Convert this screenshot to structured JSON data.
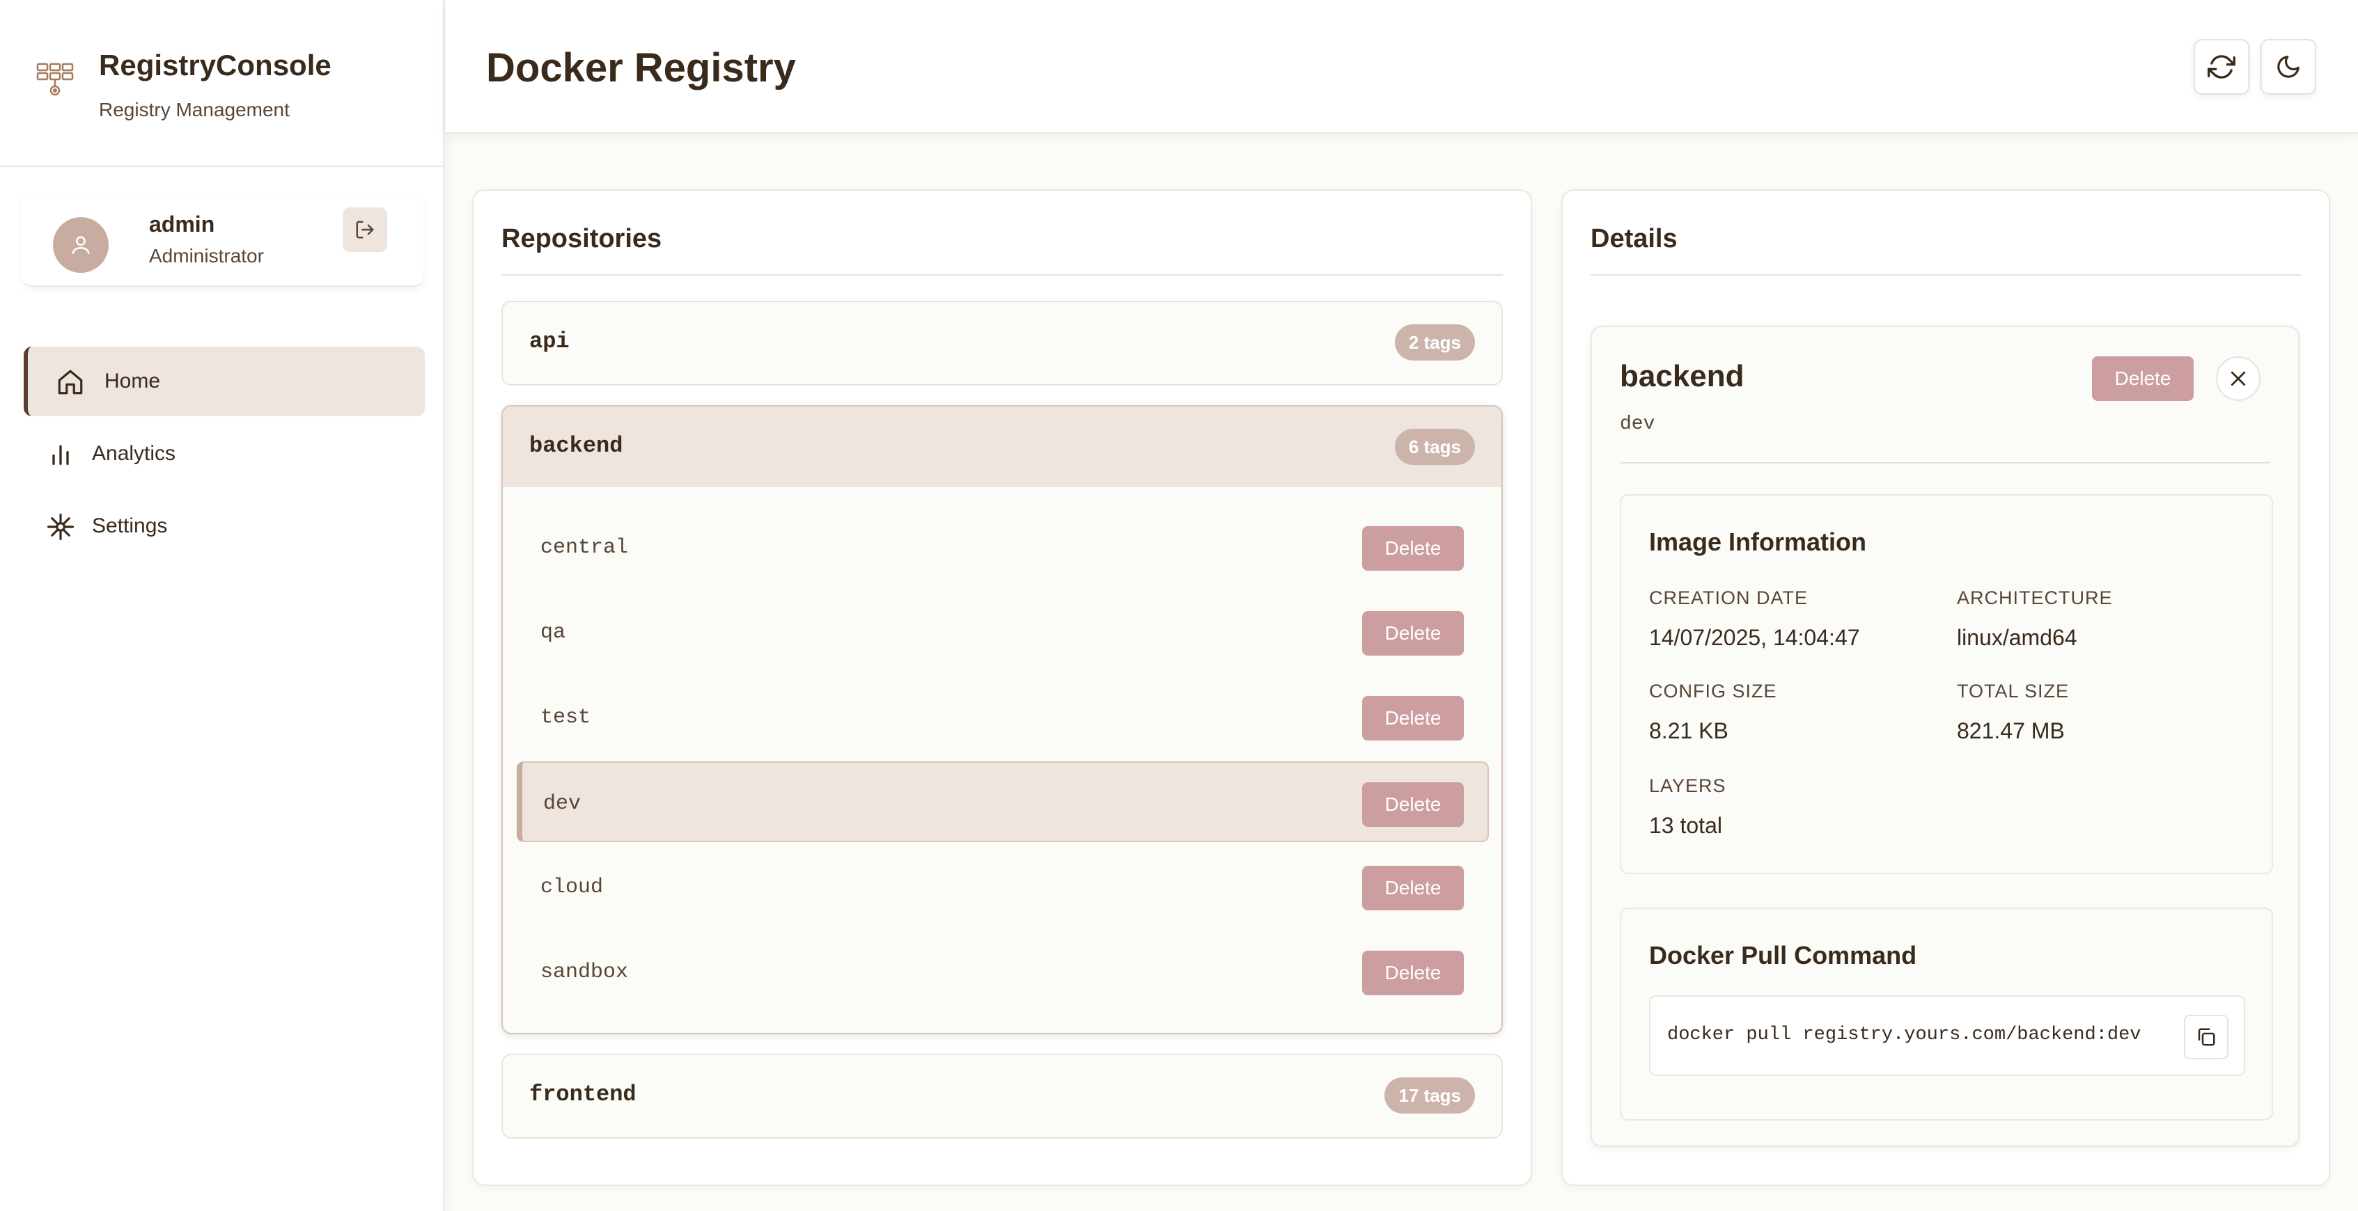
{
  "app": {
    "name": "RegistryConsole",
    "subtitle": "Registry Management"
  },
  "user": {
    "name": "admin",
    "role": "Administrator"
  },
  "nav": [
    {
      "label": "Home",
      "icon": "home-icon",
      "active": true
    },
    {
      "label": "Analytics",
      "icon": "bar-chart-icon",
      "active": false
    },
    {
      "label": "Settings",
      "icon": "gear-icon",
      "active": false
    }
  ],
  "header": {
    "title": "Docker Registry"
  },
  "repositories_panel": {
    "title": "Repositories",
    "repos": [
      {
        "name": "api",
        "tag_count": "2 tags"
      },
      {
        "name": "backend",
        "tag_count": "6 tags",
        "expanded": true,
        "tags": [
          "central",
          "qa",
          "test",
          "dev",
          "cloud",
          "sandbox"
        ],
        "selected_tag": "dev"
      },
      {
        "name": "frontend",
        "tag_count": "17 tags"
      }
    ],
    "delete_label": "Delete"
  },
  "details_panel": {
    "title": "Details",
    "repo": "backend",
    "tag": "dev",
    "delete_label": "Delete",
    "image_info": {
      "title": "Image Information",
      "creation_date_label": "CREATION DATE",
      "creation_date": "14/07/2025, 14:04:47",
      "architecture_label": "ARCHITECTURE",
      "architecture": "linux/amd64",
      "config_size_label": "CONFIG SIZE",
      "config_size": "8.21 KB",
      "total_size_label": "TOTAL SIZE",
      "total_size": "821.47 MB",
      "layers_label": "LAYERS",
      "layers": "13 total"
    },
    "pull": {
      "title": "Docker Pull Command",
      "command": "docker pull registry.yours.com/backend:dev"
    }
  },
  "colors": {
    "accent": "#5a3f2e",
    "delete": "#cc9ea0",
    "badge": "#cdb4aa",
    "active_bg": "#efe5df"
  }
}
